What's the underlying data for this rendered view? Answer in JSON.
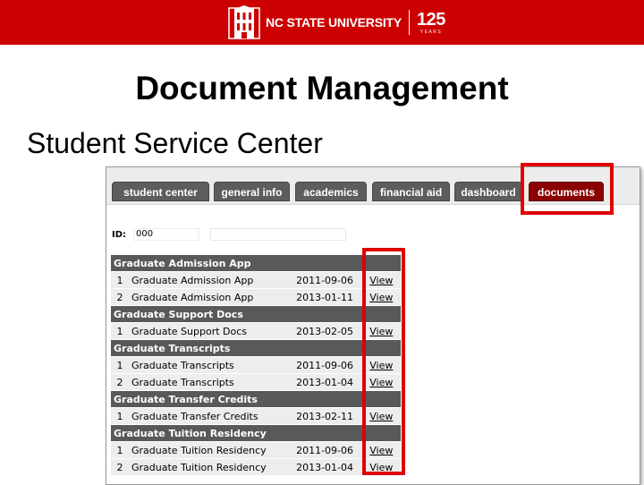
{
  "header": {
    "university": "NC STATE UNIVERSITY",
    "anniversary_number": "125",
    "anniversary_word": "YEARS"
  },
  "slide": {
    "title": "Document Management",
    "subtitle": "Student Service Center"
  },
  "tabs": [
    {
      "label": "student center",
      "active": false
    },
    {
      "label": "general info",
      "active": false
    },
    {
      "label": "academics",
      "active": false
    },
    {
      "label": "financial aid",
      "active": false
    },
    {
      "label": "dashboard",
      "active": false
    },
    {
      "label": "documents",
      "active": true
    }
  ],
  "id_field": {
    "label": "ID:",
    "value": "000"
  },
  "document_groups": [
    {
      "name": "Graduate Admission App",
      "rows": [
        {
          "num": "1",
          "doc": "Graduate Admission App",
          "date": "2011-09-06",
          "action": "View"
        },
        {
          "num": "2",
          "doc": "Graduate Admission App",
          "date": "2013-01-11",
          "action": "View"
        }
      ]
    },
    {
      "name": "Graduate Support Docs",
      "rows": [
        {
          "num": "1",
          "doc": "Graduate Support Docs",
          "date": "2013-02-05",
          "action": "View"
        }
      ]
    },
    {
      "name": "Graduate Transcripts",
      "rows": [
        {
          "num": "1",
          "doc": "Graduate Transcripts",
          "date": "2011-09-06",
          "action": "View"
        },
        {
          "num": "2",
          "doc": "Graduate Transcripts",
          "date": "2013-01-04",
          "action": "View"
        }
      ]
    },
    {
      "name": "Graduate Transfer Credits",
      "rows": [
        {
          "num": "1",
          "doc": "Graduate Transfer Credits",
          "date": "2013-02-11",
          "action": "View"
        }
      ]
    },
    {
      "name": "Graduate Tuition Residency",
      "rows": [
        {
          "num": "1",
          "doc": "Graduate Tuition Residency",
          "date": "2011-09-06",
          "action": "View"
        },
        {
          "num": "2",
          "doc": "Graduate Tuition Residency",
          "date": "2013-01-04",
          "action": "View"
        }
      ]
    }
  ],
  "colors": {
    "brand_red": "#cc0000",
    "active_tab": "#8b0000",
    "highlight": "#e00000",
    "link": "#1a4fb5"
  }
}
